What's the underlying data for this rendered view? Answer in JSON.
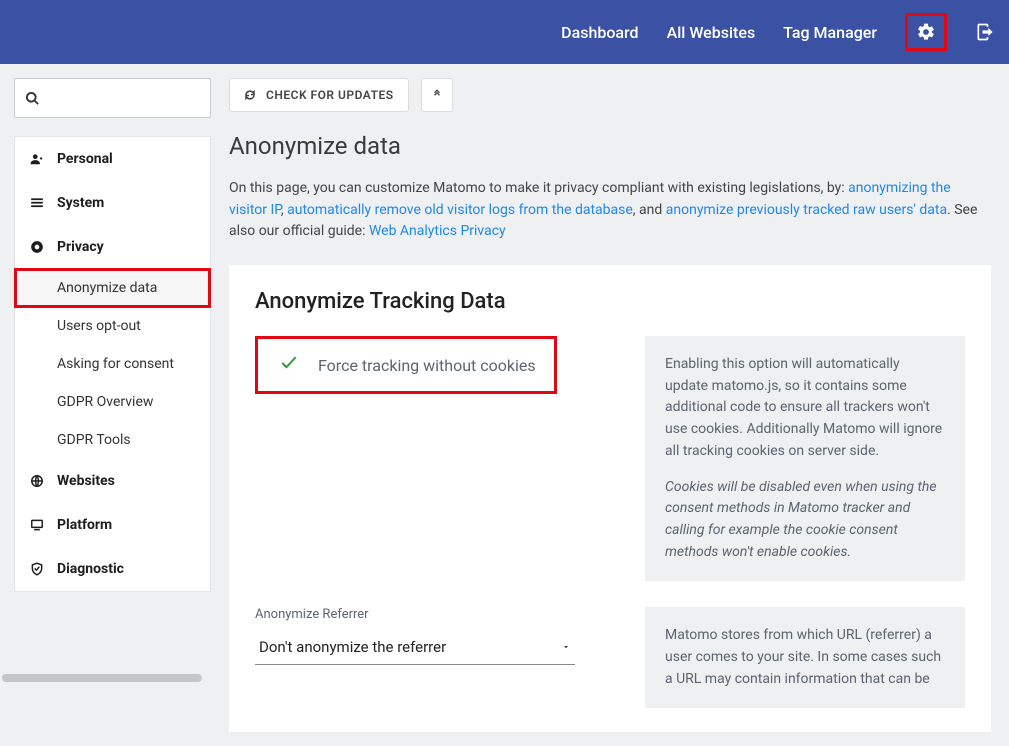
{
  "topbar": {
    "links": [
      "Dashboard",
      "All Websites",
      "Tag Manager"
    ]
  },
  "sidebar": {
    "sections": [
      {
        "label": "Personal",
        "icon": "user"
      },
      {
        "label": "System",
        "icon": "system"
      },
      {
        "label": "Privacy",
        "icon": "privacy",
        "items": [
          "Anonymize data",
          "Users opt-out",
          "Asking for consent",
          "GDPR Overview",
          "GDPR Tools"
        ]
      },
      {
        "label": "Websites",
        "icon": "globe"
      },
      {
        "label": "Platform",
        "icon": "platform"
      },
      {
        "label": "Diagnostic",
        "icon": "shield"
      }
    ]
  },
  "toolbar": {
    "check_updates": "CHECK FOR UPDATES"
  },
  "page": {
    "title": "Anonymize data",
    "intro_pre": "On this page, you can customize Matomo to make it privacy compliant with existing legislations, by: ",
    "link1": "anonymizing the visitor IP",
    "comma1": ", ",
    "link2": "automatically remove old visitor logs from the database",
    "mid": ", and ",
    "link3": "anonymize previously tracked raw users' data",
    "post": ". See also our official guide: ",
    "link4": "Web Analytics Privacy"
  },
  "card": {
    "title": "Anonymize Tracking Data",
    "force_label": "Force tracking without cookies",
    "help1": "Enabling this option will automatically update matomo.js, so it contains some additional code to ensure all trackers won't use cookies. Additionally Matomo will ignore all tracking cookies on server side.",
    "help1_em": "Cookies will be disabled even when using the consent methods in Matomo tracker and calling for example the cookie consent methods won't enable cookies.",
    "referrer_label": "Anonymize Referrer",
    "referrer_value": "Don't anonymize the referrer",
    "help2": "Matomo stores from which URL (referrer) a user comes to your site. In some cases such a URL may contain information that can be"
  }
}
